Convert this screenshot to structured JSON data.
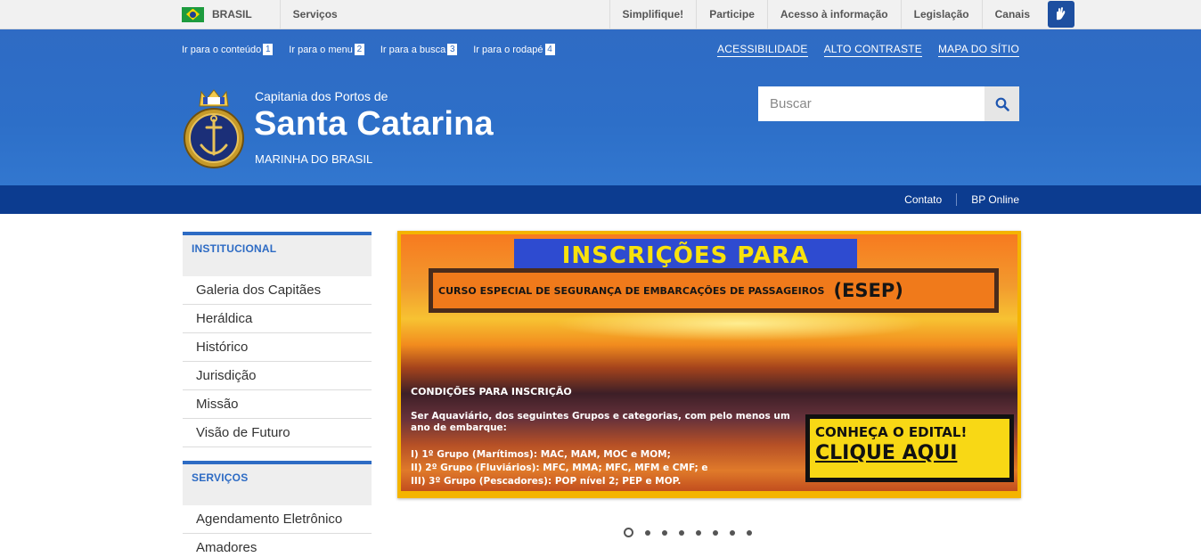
{
  "gov_bar": {
    "country": "BRASIL",
    "services": "Serviços",
    "links": [
      "Simplifique!",
      "Participe",
      "Acesso à informação",
      "Legislação",
      "Canais"
    ]
  },
  "accessibility_links": [
    {
      "label": "Ir para o conteúdo",
      "key": "1"
    },
    {
      "label": "Ir para o menu",
      "key": "2"
    },
    {
      "label": "Ir para a busca",
      "key": "3"
    },
    {
      "label": "Ir para o rodapé",
      "key": "4"
    }
  ],
  "top_right_links": [
    "ACESSIBILIDADE",
    "ALTO CONTRASTE",
    "MAPA DO SÍTIO"
  ],
  "header": {
    "subtitle": "Capitania dos Portos de",
    "title": "Santa Catarina",
    "owner": "MARINHA DO BRASIL",
    "logo_text": "MARINHA DO BRASIL"
  },
  "search": {
    "placeholder": "Buscar"
  },
  "service_bar": [
    "Contato",
    "BP Online"
  ],
  "sidebar": [
    {
      "title": "INSTITUCIONAL",
      "items": [
        "Galeria dos Capitães",
        "Heráldica",
        "Histórico",
        "Jurisdição",
        "Missão",
        "Visão de Futuro"
      ]
    },
    {
      "title": "SERVIÇOS",
      "items": [
        "Agendamento Eletrônico",
        "Amadores"
      ]
    }
  ],
  "banner": {
    "heading": "INSCRIÇÕES PARA",
    "course": "CURSO ESPECIAL DE SEGURANÇA DE EMBARCAÇÕES DE PASSAGEIROS",
    "course_abbr": "(ESEP)",
    "conditions": "CONDIÇÕES PARA INSCRIÇÃO",
    "requirement": "Ser Aquaviário, dos seguintes Grupos e categorias, com pelo menos um ano de embarque:",
    "groups": [
      "I) 1º Grupo (Marítimos): MAC, MAM, MOC e MOM;",
      "II) 2º Grupo (Fluviários): MFC, MMA; MFC, MFM e CMF; e",
      "III) 3º Grupo (Pescadores): POP nível 2; PEP e MOP."
    ],
    "cta_line1": "CONHEÇA O EDITAL!",
    "cta_line2": "CLIQUE AQUI"
  },
  "carousel": {
    "slide_count": 8,
    "active_index": 0
  },
  "colors": {
    "header_blue": "#2d6bc4",
    "service_bar": "#0c3c90",
    "gov_bar": "#f1f1f1",
    "banner_frame": "#f4b400"
  }
}
